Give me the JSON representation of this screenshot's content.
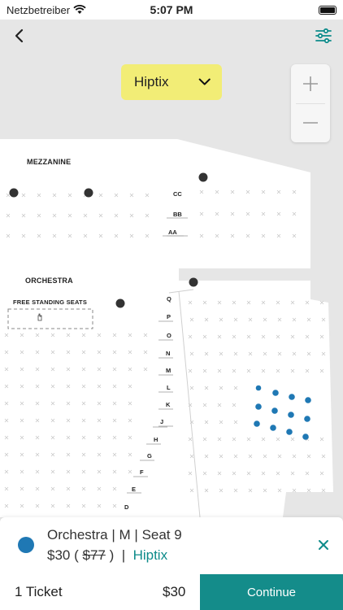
{
  "status_bar": {
    "carrier": "Netzbetreiber",
    "time": "5:07 PM"
  },
  "header": {
    "back_icon": "chevron-left-icon",
    "filter_icon": "sliders-icon",
    "vendor_selected": "Hiptix",
    "accent_color": "#0d8b8a",
    "dropdown_color": "#f2ed76"
  },
  "zoom": {
    "zoom_in": "+",
    "zoom_out": "−"
  },
  "map": {
    "sections": {
      "mezzanine": "MEZZANINE",
      "orchestra": "ORCHESTRA",
      "free_standing": "FREE STANDING SEATS"
    },
    "mezzanine_rows": [
      "CC",
      "BB",
      "AA"
    ],
    "orchestra_rows": [
      "Q",
      "P",
      "O",
      "N",
      "M",
      "L",
      "K",
      "J",
      "H",
      "G",
      "F",
      "E",
      "D"
    ]
  },
  "selection": {
    "section": "Orchestra",
    "row": "M",
    "seat": "Seat 9",
    "price": "$30",
    "original_price": "$77",
    "vendor": "Hiptix",
    "seat_color": "#1f78b4"
  },
  "checkout": {
    "ticket_count": "1 Ticket",
    "total": "$30",
    "continue_label": "Continue",
    "button_color": "#148c8a"
  }
}
